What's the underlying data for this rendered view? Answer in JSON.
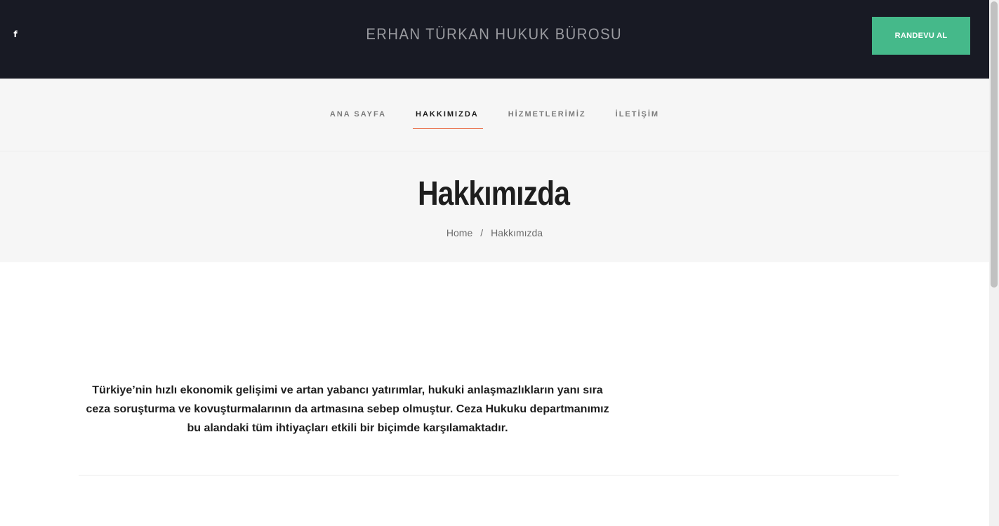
{
  "header": {
    "social_icon": "facebook-icon",
    "social_icon_glyph": "f",
    "site_title": "ERHAN TÜRKAN HUKUK BÜROSU",
    "cta_label": "RANDEVU AL"
  },
  "nav": {
    "items": [
      {
        "label": "ANA SAYFA",
        "active": false
      },
      {
        "label": "HAKKIMIZDA",
        "active": true
      },
      {
        "label": "HİZMETLERİMİZ",
        "active": false
      },
      {
        "label": "İLETİŞİM",
        "active": false
      }
    ]
  },
  "page_header": {
    "title": "Hakkımızda",
    "breadcrumb": {
      "home": "Home",
      "separator": "/",
      "current": "Hakkımızda"
    }
  },
  "content": {
    "paragraph": "Türkiye’nin hızlı ekonomik gelişimi ve artan yabancı yatırımlar, hukuki anlaşmazlıkların yanı sıra ceza soruşturma ve kovuşturmalarının da artmasına sebep olmuştur. Ceza Hukuku departmanımız bu alandaki tüm ihtiyaçları etkili bir biçimde karşılamaktadır."
  },
  "colors": {
    "topbar_bg": "#181a24",
    "cta_bg": "#45b98a",
    "nav_active_underline": "#e8623a",
    "header_bg": "#f6f6f6"
  }
}
